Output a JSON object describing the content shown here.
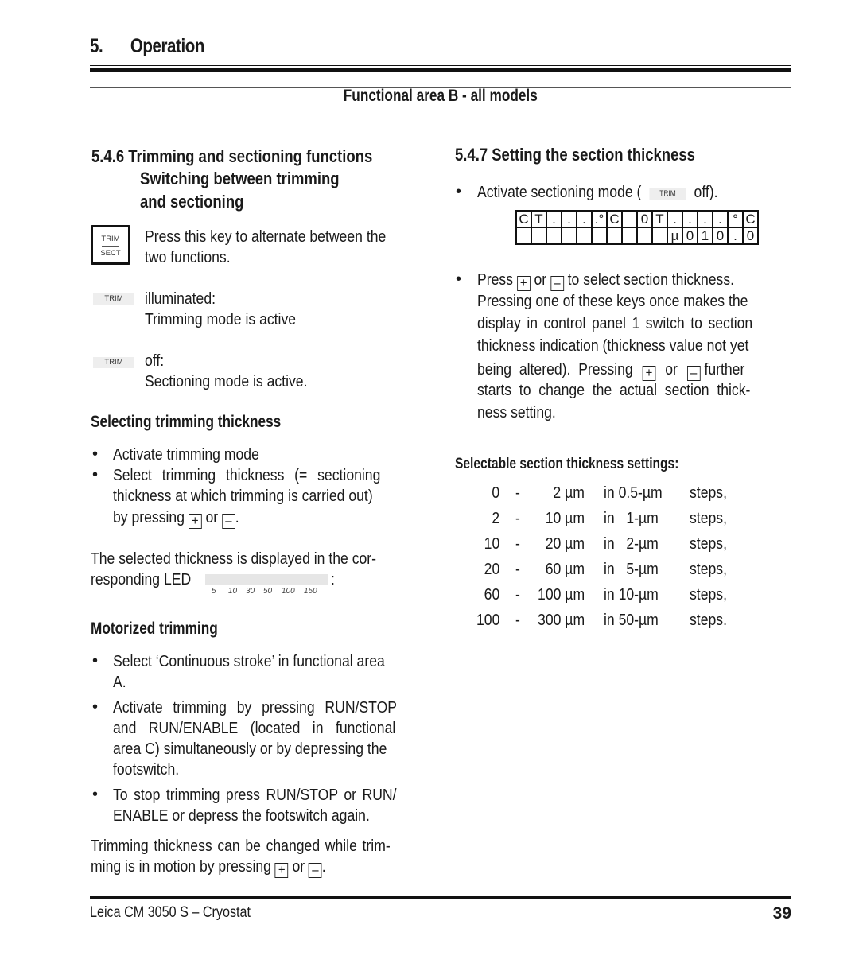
{
  "header": {
    "chapter_number": "5.",
    "chapter_title": "Operation",
    "subtitle": "Functional area B - all models"
  },
  "left": {
    "section_title_line1": "5.4.6 Trimming and sectioning functions",
    "section_title_line2": "Switching between trimming",
    "section_title_line3": "and sectioning",
    "key_top": "TRIM",
    "key_bottom": "SECT",
    "key_desc_line1": "Press this key to alternate between the",
    "key_desc_line2": "two functions.",
    "trim_led_label": "TRIM",
    "illuminated_label": "illuminated:",
    "illuminated_desc": "Trimming mode is active",
    "off_label": "off:",
    "off_desc": "Sectioning mode is active.",
    "selecting_heading": "Selecting trimming thickness",
    "selecting_bullets": [
      "Activate trimming mode",
      "Select trimming thickness (= sectioning",
      "thickness at which trimming is carried out)",
      "by pressing"
    ],
    "or_word": "or",
    "plus_symbol": "+",
    "minus_symbol": "–",
    "led_text_line1": "The selected thickness is displayed in the  cor-",
    "led_text_line2": "responding LED",
    "led_colon": ":",
    "led_scale": [
      "5",
      "10",
      "30",
      "50",
      "100",
      "150"
    ],
    "motorized_heading": "Motorized trimming",
    "motorized_bullets": [
      [
        "Select ‘Continuous stroke’ in functional area",
        "A."
      ],
      [
        "Activate trimming by pressing RUN/STOP",
        "and RUN/ENABLE (located in functional",
        "area C) simultaneously or by depressing the",
        "footswitch."
      ],
      [
        "To stop trimming press RUN/STOP or RUN/",
        "ENABLE or depress the footswitch again."
      ]
    ],
    "closing_line1": "Trimming thickness can be changed while trim-",
    "closing_line2": "ming is in motion by pressing",
    "bullet_char": "•"
  },
  "right": {
    "section_title": "5.4.7 Setting the section thickness",
    "activate_text": "Activate sectioning mode (",
    "activate_trim": "TRIM",
    "activate_end": "off).",
    "lcd_row1": [
      "C",
      "T",
      ".",
      ".",
      ".",
      ".°",
      "C",
      "",
      "0",
      "T",
      ".",
      ".",
      ".",
      ".",
      "°",
      "C"
    ],
    "lcd_row2": [
      "",
      "",
      "",
      "",
      "",
      "",
      "",
      "",
      "",
      "",
      "µ",
      "0",
      "1",
      "0",
      ".",
      "0"
    ],
    "press_lines": [
      "Press",
      "to select section thickness.",
      "Pressing one of these keys once makes the",
      "display in control panel 1 switch to section",
      "thickness indication (thickness value not yet",
      "being  altered).  Pressing",
      "further",
      "starts  to  change  the  actual  section  thick-",
      "ness setting."
    ],
    "table_heading": "Selectable section thickness settings:",
    "table_rows": [
      {
        "from": "0",
        "to": "2 µm",
        "step": "in 0.5-µm",
        "end": "steps,"
      },
      {
        "from": "2",
        "to": "10 µm",
        "step": "in   1-µm",
        "end": "steps,"
      },
      {
        "from": "10",
        "to": "20 µm",
        "step": "in   2-µm",
        "end": "steps,"
      },
      {
        "from": "20",
        "to": "60 µm",
        "step": "in   5-µm",
        "end": "steps,"
      },
      {
        "from": "60",
        "to": "100 µm",
        "step": "in 10-µm",
        "end": "steps,"
      },
      {
        "from": "100",
        "to": "300 µm",
        "step": "in 50-µm",
        "end": "steps."
      }
    ],
    "dash": "-"
  },
  "footer": {
    "product": "Leica CM 3050 S – Cryostat",
    "page_number": "39"
  }
}
